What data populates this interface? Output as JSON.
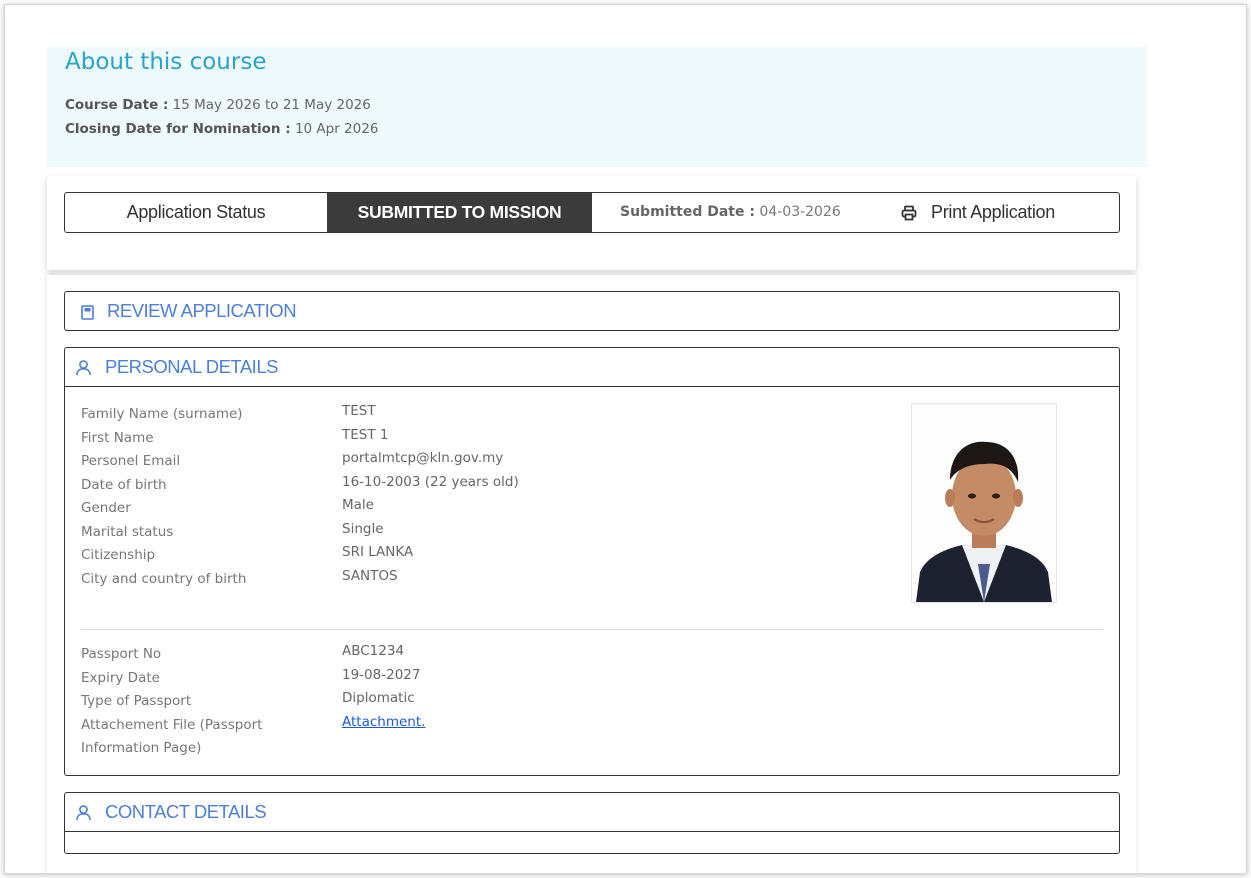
{
  "about": {
    "title": "About this course",
    "course_date_label": "Course Date :",
    "course_date_value": "15 May 2026 to 21 May 2026",
    "closing_date_label": "Closing Date for Nomination :",
    "closing_date_value": "10 Apr 2026"
  },
  "status": {
    "label": "Application Status",
    "value": "SUBMITTED TO MISSION",
    "submitted_label": "Submitted Date :",
    "submitted_value": "04-03-2026",
    "print_label": "Print Application",
    "print_icon": "printer-icon"
  },
  "review": {
    "label": "REVIEW APPLICATION",
    "icon": "save-icon"
  },
  "personal": {
    "title": "PERSONAL DETAILS",
    "icon": "user-icon",
    "fields": [
      {
        "label": "Family Name (surname)",
        "value": "TEST"
      },
      {
        "label": "First Name",
        "value": "TEST 1"
      },
      {
        "label": "Personel Email",
        "value": "portalmtcp@kln.gov.my"
      },
      {
        "label": "Date of birth",
        "value": "16-10-2003 (22 years old)"
      },
      {
        "label": "Gender",
        "value": "Male"
      },
      {
        "label": "Marital status",
        "value": "Single"
      },
      {
        "label": "Citizenship",
        "value": "SRI LANKA"
      },
      {
        "label": "City and country of birth",
        "value": "SANTOS"
      }
    ],
    "passport_fields": [
      {
        "label": "Passport No",
        "value": "ABC1234"
      },
      {
        "label": "Expiry Date",
        "value": "19-08-2027"
      },
      {
        "label": "Type of Passport",
        "value": "Diplomatic"
      },
      {
        "label": "Attachement File (Passport Information Page)",
        "value": "Attachment."
      }
    ]
  },
  "contact": {
    "title": "CONTACT DETAILS",
    "icon": "user-icon"
  },
  "colors": {
    "accent": "#2aa3c9",
    "link": "#4c7fd6",
    "status_bg": "#3b3b3b"
  }
}
